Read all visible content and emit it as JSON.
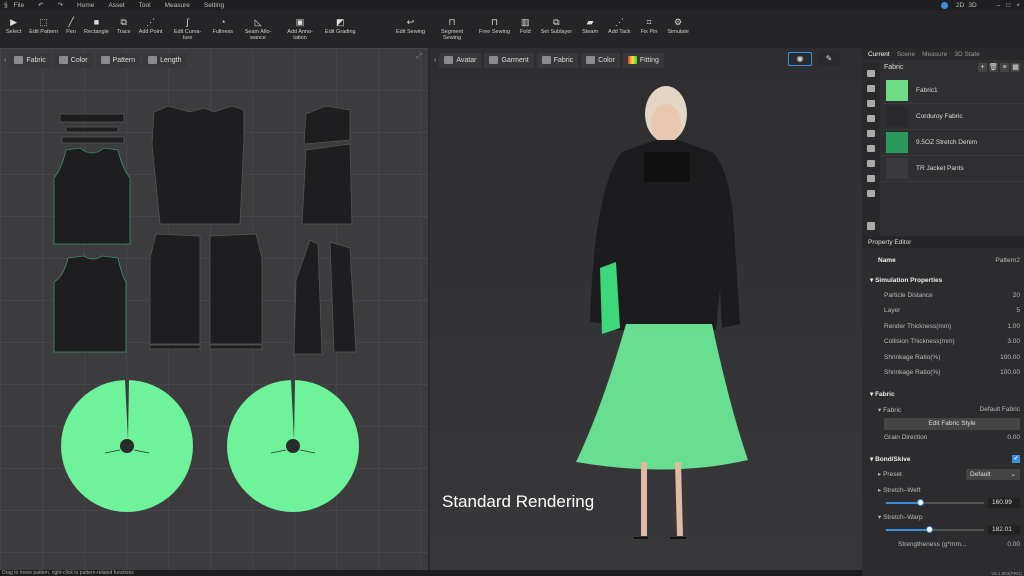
{
  "menu": {
    "items": [
      "File",
      "Home",
      "Asset",
      "Tool",
      "Measure",
      "Setting"
    ]
  },
  "window": {
    "view_modes": [
      "2D",
      "3D"
    ]
  },
  "toolbar_2d": [
    "Select",
    "Edit Pattern",
    "Pen",
    "Rectangle",
    "Trace",
    "Add Point",
    "Edit Curva-ture",
    "Fullness",
    "Seam Allo-wance",
    "Add Anno-tation",
    "Edit Grading"
  ],
  "toolbar_3d": [
    "Edit Sewing",
    "Segment Sewing",
    "Free Sewing",
    "Fold",
    "Set Sublayer",
    "Steam",
    "Add Tack",
    "Fix Pin",
    "Simulate"
  ],
  "panel2d": {
    "chips": [
      "Fabric",
      "Color",
      "Pattern",
      "Length"
    ]
  },
  "panel3d": {
    "chips": [
      "Avatar",
      "Garment",
      "Fabric",
      "Color",
      "Fitting"
    ],
    "render_label": "Standard Rendering"
  },
  "right": {
    "tabs": [
      "Current",
      "Scene",
      "Measure",
      "3D State"
    ],
    "fabric_header": "Fabric",
    "fabrics": [
      {
        "name": "Fabric1",
        "color": "#6fdc84"
      },
      {
        "name": "Corduroy Fabric",
        "color": "#2a2a2c"
      },
      {
        "name": "9.5OZ Stretch Denim",
        "color": "#2a9a5a"
      },
      {
        "name": "TR Jacket Pants",
        "color": "#3a3a3c"
      }
    ],
    "property_editor": {
      "title": "Property Editor",
      "name_label": "Name",
      "name_value": "Pattern2",
      "sim_header": "Simulation Properties",
      "sim": [
        {
          "label": "Particle Distance",
          "value": "20"
        },
        {
          "label": "Layer",
          "value": "5"
        },
        {
          "label": "Render Thickness(mm)",
          "value": "1.00"
        },
        {
          "label": "Collision Thickness(mm)",
          "value": "3.00"
        },
        {
          "label": "Shrinkage Ratio(%)",
          "value": "100.00"
        },
        {
          "label": "Shrinkage Ratio(%)",
          "value": "100.00"
        }
      ],
      "fabric_header": "Fabric",
      "fabric_label": "Fabric",
      "fabric_value": "Default Fabric",
      "edit_fabric_style": "Edit  Fabric Style",
      "grain_label": "Grain Direction",
      "grain_value": "0.00",
      "bond_header": "Bond/Skive",
      "bond_checked": true,
      "preset_label": "Preset",
      "preset_value": "Default",
      "weft_label": "Stretch–Weft",
      "weft_value": "160.99",
      "weft_fraction": 0.35,
      "warp_label": "Stretch–Warp",
      "warp_value": "182.01",
      "warp_fraction": 0.44,
      "strength_label": "Strengtheness  (g*mm...",
      "strength_value": "0.00"
    },
    "version": "V6.1.893(PRO)"
  },
  "status": "Drag to move pattern, right-click to pattern-related functions",
  "colors": {
    "accent": "#3c8ee0",
    "skirt": "#6ef29a",
    "jacket": "#1c1c1e"
  }
}
